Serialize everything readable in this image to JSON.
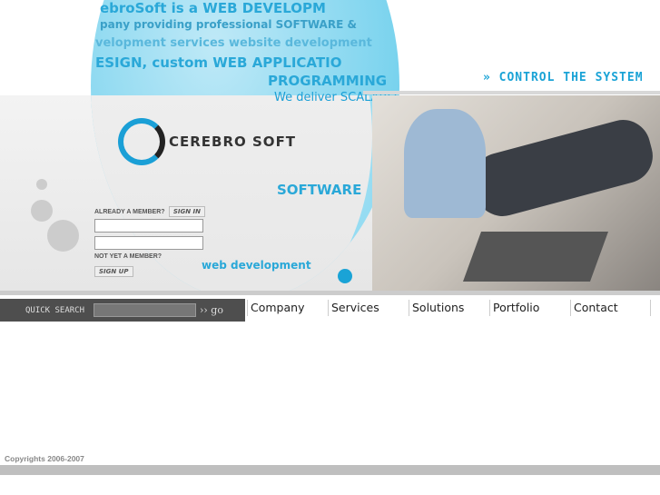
{
  "banner": {
    "tagline": "» CONTROL THE SYSTEM",
    "logo": "CEREBRO SOFT",
    "decor_text": [
      "ebroSoft is a WEB DEVELOPM",
      "pany providing professional SOFTWARE &",
      "velopment services website development",
      "ESIGN, custom WEB APPLICATIO",
      "PROGRAMMING",
      "We deliver SCALABLE",
      "SOFTWARE",
      "web development"
    ]
  },
  "login": {
    "member_label": "ALREADY A MEMBER?",
    "sign_in": "SIGN IN",
    "not_member_label": "NOT YET A MEMBER?",
    "sign_up": "SIGN UP"
  },
  "search": {
    "label": "QUICK SEARCH",
    "go": "›› go",
    "value": ""
  },
  "nav": {
    "items": [
      "Company",
      "Services",
      "Solutions",
      "Portfolio",
      "Contact"
    ]
  },
  "footer": {
    "copyright": "Copyrights 2006-2007"
  },
  "colors": {
    "accent": "#1aa3d6",
    "search_bar": "#4e4e4e"
  }
}
